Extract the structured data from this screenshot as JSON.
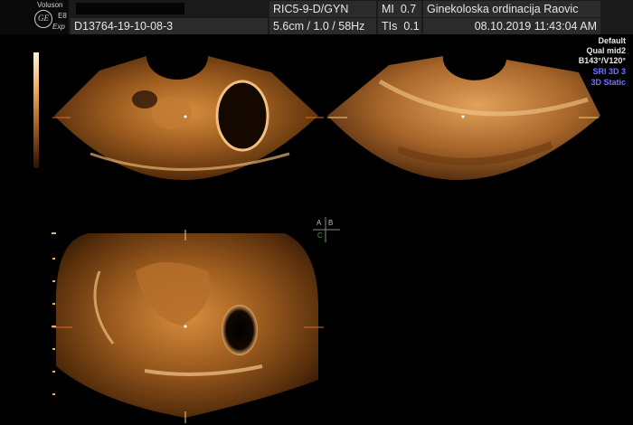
{
  "header": {
    "brand": "Voluson",
    "model": "E8",
    "mode": "Exp",
    "logo": "GE",
    "patient_id": "D13764-19-10-08-3",
    "probe": "RIC5-9-D/GYN",
    "mi_label": "MI",
    "mi_value": "0.7",
    "clinic": "Ginekoloska ordinacija Raovic",
    "depth": "5.6cm / 1.0 / 58Hz",
    "tis_label": "TIs",
    "tis_value": "0.1",
    "datetime": "08.10.2019 11:43:04 AM"
  },
  "settings": {
    "line1": "Default",
    "line2": "Qual mid2",
    "line3": "B143°/V120°",
    "line4": "SRI 3D 3",
    "line5": "3D Static"
  },
  "orientation": {
    "a": "A",
    "b": "B",
    "c": "C"
  },
  "colors": {
    "tissue": "#c57a2e",
    "highlight": "#f2c68a",
    "panel_bg": "#000000",
    "accent_blue": "#6f74ff",
    "marker_green": "#3aa83a",
    "marker_orange": "#e06a1a"
  }
}
